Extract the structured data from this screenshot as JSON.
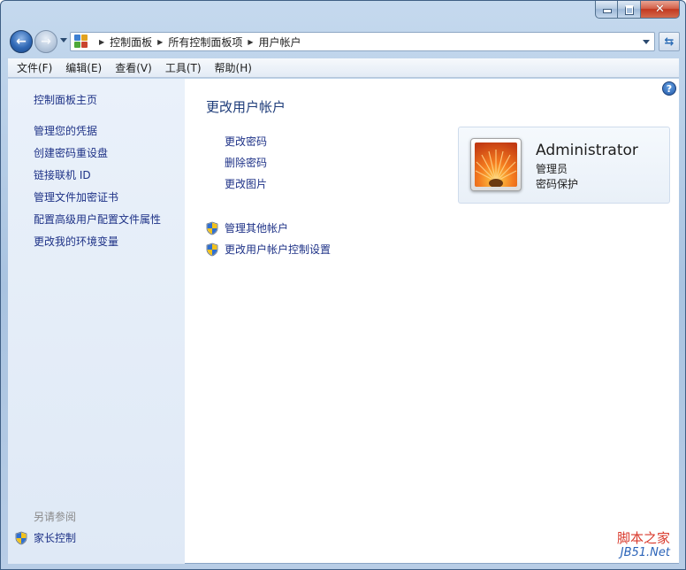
{
  "window": {
    "caption_icons": [
      "minimize-icon",
      "maximize-icon",
      "close-icon"
    ]
  },
  "nav": {
    "breadcrumbs": [
      "控制面板",
      "所有控制面板项",
      "用户帐户"
    ]
  },
  "menu": [
    "文件(F)",
    "编辑(E)",
    "查看(V)",
    "工具(T)",
    "帮助(H)"
  ],
  "sidebar": {
    "links": [
      "控制面板主页",
      "管理您的凭据",
      "创建密码重设盘",
      "链接联机 ID",
      "管理文件加密证书",
      "配置高级用户配置文件属性",
      "更改我的环境变量"
    ],
    "see_also_heading": "另请参阅",
    "see_also_link": "家长控制"
  },
  "main": {
    "title": "更改用户帐户",
    "tasks": [
      "更改密码",
      "删除密码",
      "更改图片"
    ],
    "shield_tasks": [
      "管理其他帐户",
      "更改用户帐户控制设置"
    ],
    "help": "?"
  },
  "account": {
    "name": "Administrator",
    "role": "管理员",
    "status": "密码保护"
  },
  "watermark": {
    "line1": "脚本之家",
    "line2": "JB51.Net"
  },
  "colors": {
    "link": "#1e3287",
    "title": "#1e3c7a",
    "sidebar_bg": "#e3ecf7",
    "frame": "#b8cde6"
  }
}
